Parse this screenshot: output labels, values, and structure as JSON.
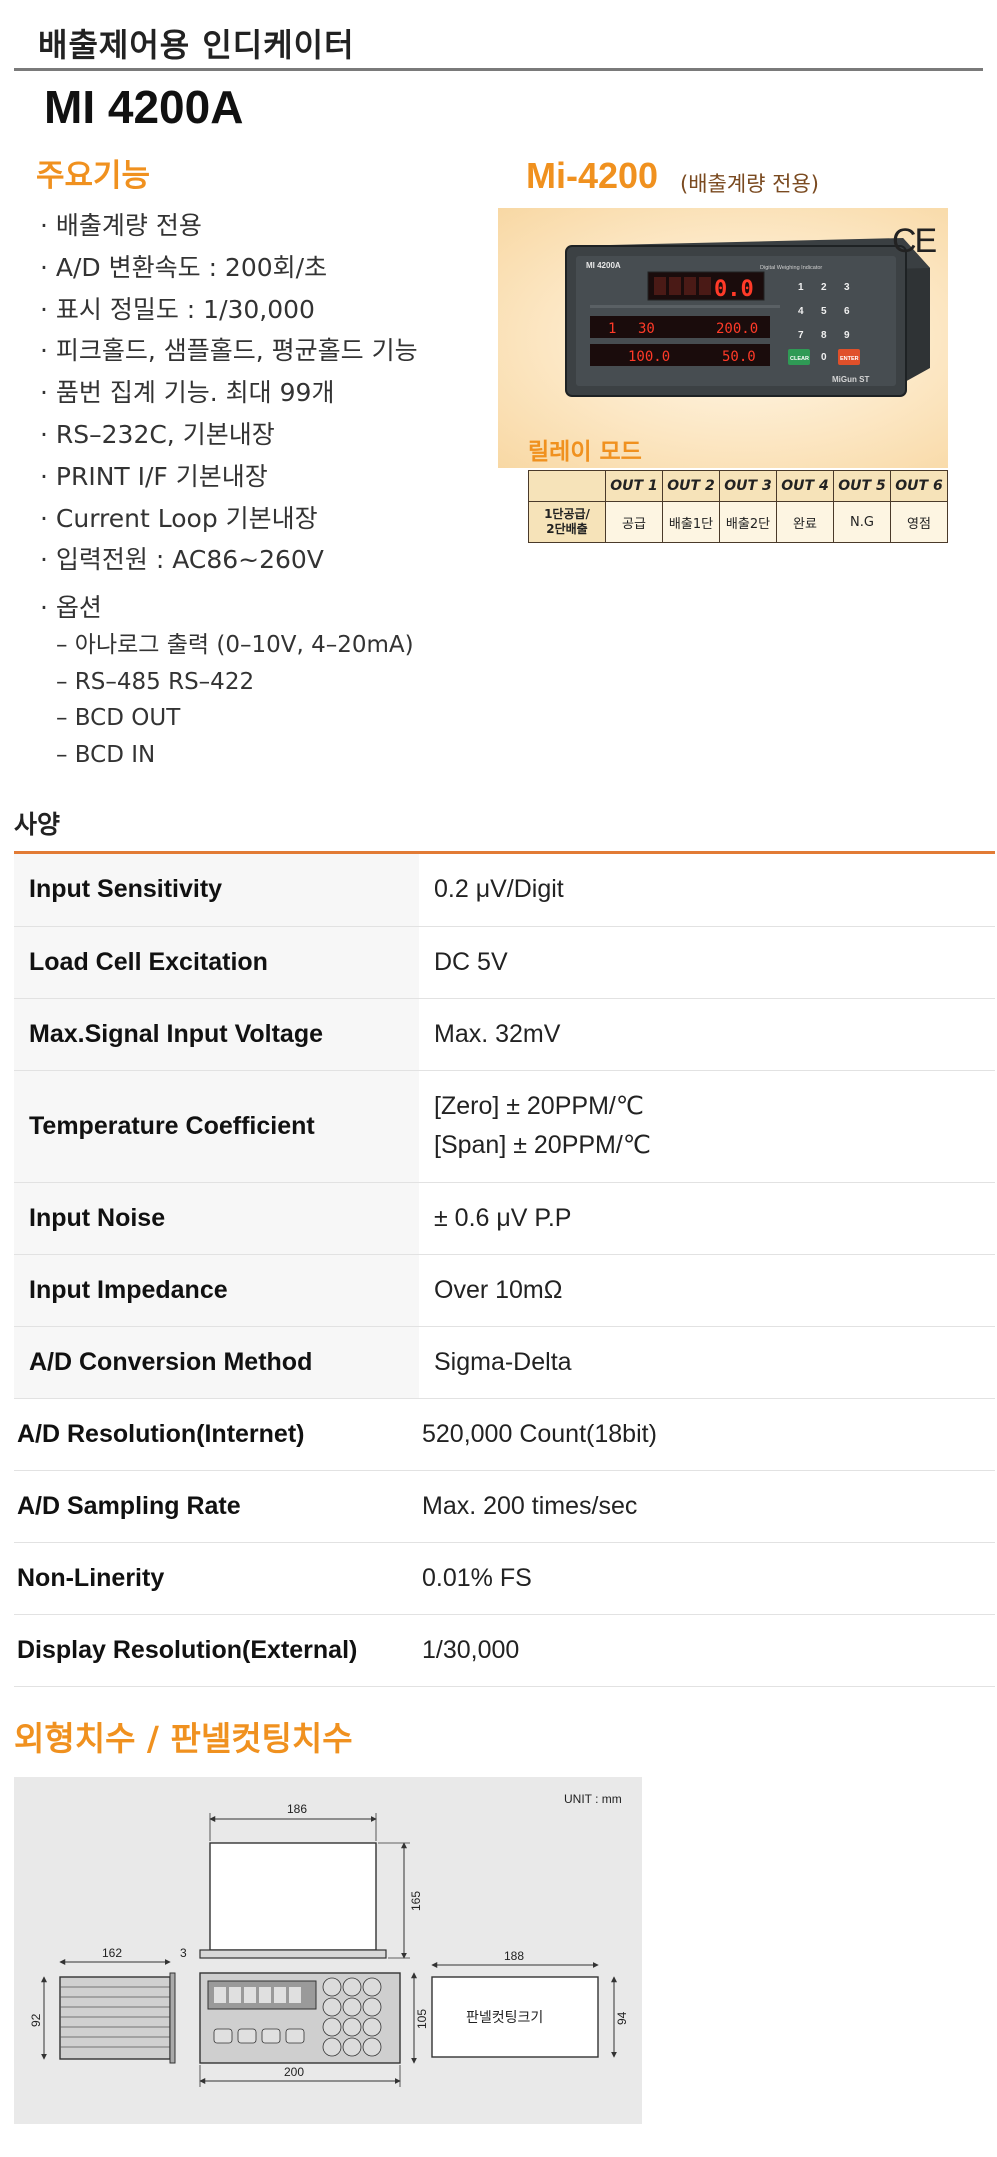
{
  "header": {
    "title": "배출제어용 인디케이터",
    "model": "MI 4200A"
  },
  "features": {
    "title": "주요기능",
    "items": [
      "· 배출계량 전용",
      "· A/D 변환속도 : 200회/초",
      "· 표시 정밀도 : 1/30,000",
      "· 피크홀드, 샘플홀드, 평균홀드 기능",
      "· 품번 집계 기능. 최대 99개",
      "· RS–232C, 기본내장",
      "· PRINT I/F 기본내장",
      "· Current Loop 기본내장",
      "· 입력전원 : AC86~260V"
    ],
    "options_title": "· 옵션",
    "options": [
      "– 아나로그 출력 (0–10V, 4–20mA)",
      "– RS–485 RS–422",
      "– BCD OUT",
      "– BCD IN"
    ]
  },
  "product": {
    "model": "Mi-4200",
    "subtitle": "(배출계량 전용)",
    "ce_mark": "CE",
    "device": {
      "model_label": "MI 4200A",
      "brand_caption": "Digital Weighing Indicator",
      "main_display": "0.0",
      "row1_left": "1",
      "row1_mid": "30",
      "row1_right": "200.0",
      "row2_left": "100.0",
      "row2_right": "50.0",
      "keys": [
        "1",
        "2",
        "3",
        "4",
        "5",
        "6",
        "7",
        "8",
        "9",
        "0"
      ],
      "clear_label": "CLEAR",
      "enter_label": "ENTER",
      "maker": "MiGun ST"
    }
  },
  "relay": {
    "title": "릴레이 모드",
    "columns": [
      "",
      "OUT 1",
      "OUT 2",
      "OUT 3",
      "OUT 4",
      "OUT 5",
      "OUT 6"
    ],
    "row_label_1": "1단공급/",
    "row_label_2": "2단배출",
    "values": [
      "공급",
      "배출1단",
      "배출2단",
      "완료",
      "N.G",
      "영점"
    ]
  },
  "specs": {
    "title": "사양",
    "rows": [
      {
        "key": "Input Sensitivity",
        "value": "0.2 μV/Digit"
      },
      {
        "key": "Load Cell Excitation",
        "value": "DC 5V"
      },
      {
        "key": "Max.Signal Input Voltage",
        "value": "Max. 32mV"
      },
      {
        "key": "Temperature Coefficient",
        "value": "[Zero] ± 20PPM/℃",
        "value2": "[Span] ± 20PPM/℃"
      },
      {
        "key": "Input Noise",
        "value": "± 0.6 μV P.P"
      },
      {
        "key": "Input Impedance",
        "value": "Over 10mΩ"
      },
      {
        "key": "A/D Conversion Method",
        "value": "Sigma-Delta"
      },
      {
        "key": "A/D Resolution(Internet)",
        "value": "520,000 Count(18bit)"
      },
      {
        "key": "A/D Sampling Rate",
        "value": "Max. 200 times/sec"
      },
      {
        "key": "Non-Linerity",
        "value": "0.01% FS"
      },
      {
        "key": "Display Resolution(External)",
        "value": "1/30,000"
      }
    ]
  },
  "dimensions": {
    "title": "외형치수 / 판넬컷팅치수",
    "unit": "UNIT : mm",
    "top_width": "186",
    "top_height": "165",
    "side_depth": "162",
    "bezel": "3",
    "front_height": "92",
    "front_width": "200",
    "front_panel_height": "105",
    "cut_width": "188",
    "cut_height": "94",
    "cut_label": "판넬컷팅크기"
  }
}
